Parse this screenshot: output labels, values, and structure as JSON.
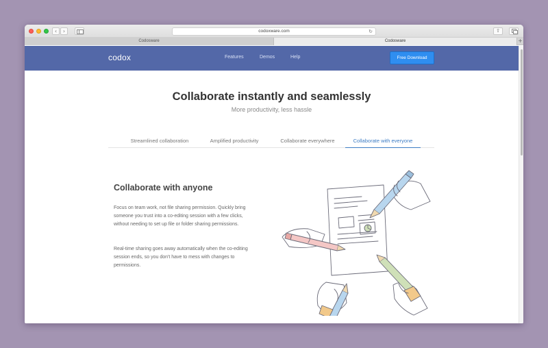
{
  "browser": {
    "url": "codoxware.com",
    "tabs": [
      {
        "label": "Codosware",
        "active": false
      },
      {
        "label": "Codosware",
        "active": true
      }
    ]
  },
  "site": {
    "logo": "codox",
    "nav": [
      "Features",
      "Demos",
      "Help"
    ],
    "cta": "Free Download",
    "header_color": "#5368a8",
    "cta_color": "#2f8ef0"
  },
  "hero": {
    "title": "Collaborate instantly and seamlessly",
    "subtitle": "More productivity, less hassle"
  },
  "feature_tabs": {
    "items": [
      "Streamlined collaboration",
      "Amplified productivity",
      "Collaborate everywhere",
      "Collaborate with everyone"
    ],
    "active": "Collaborate with everyone",
    "accent_color": "#3d7cc4"
  },
  "feature": {
    "title": "Collaborate with anyone",
    "paragraph_1": "Focus on team work, not file sharing permission. Quickly bring someone you trust into a co-editing session with a few clicks, without needing to set up file or folder sharing permissions.",
    "paragraph_2": "Real-time sharing goes away automatically when the co-editing session ends, so you don't have to mess with changes to permissions."
  },
  "icons": {
    "reload": "reload-icon",
    "back": "chevron-left-icon",
    "forward": "chevron-right-icon",
    "share": "share-icon",
    "tabs": "tabs-overview-icon",
    "sidebar": "sidebar-icon",
    "new_tab": "plus-icon"
  }
}
